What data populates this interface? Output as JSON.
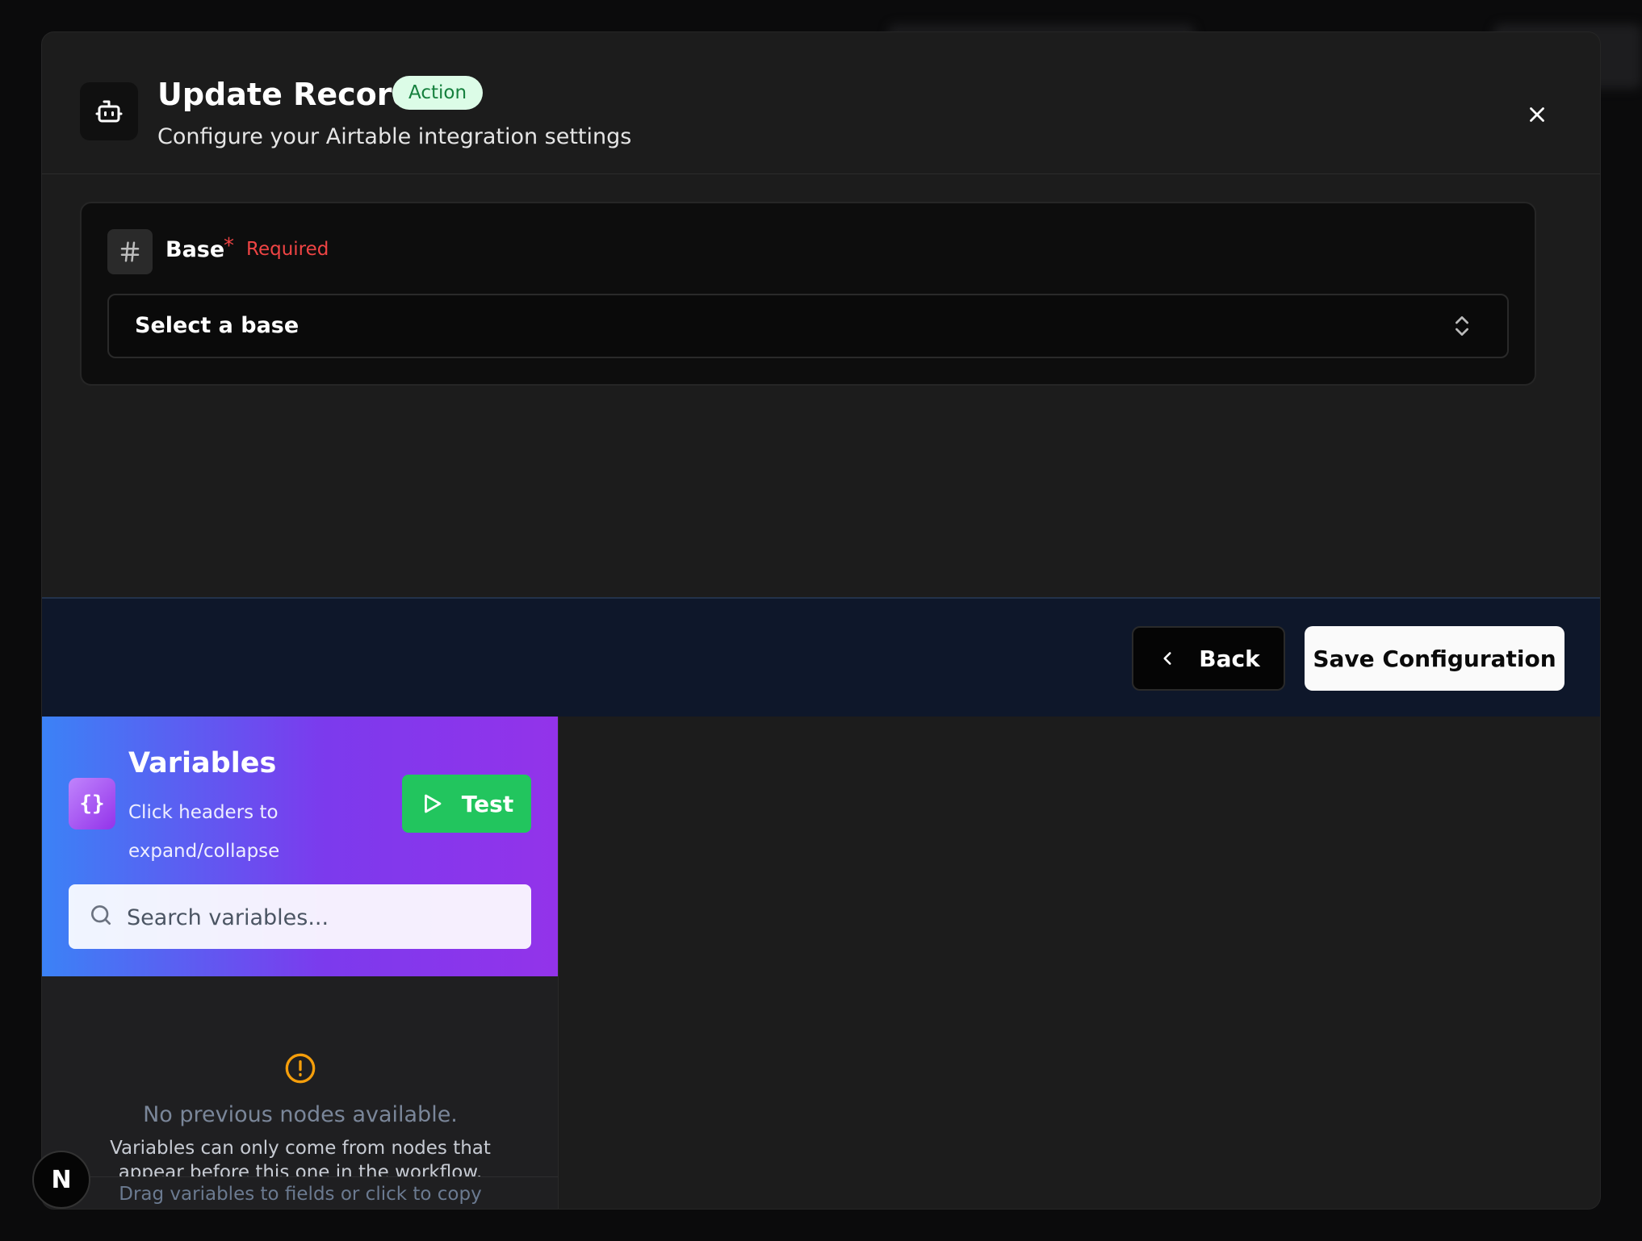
{
  "header": {
    "title": "Update Record",
    "badge": "Action",
    "subtitle": "Configure your Airtable integration settings",
    "icon": "bot-icon",
    "close_icon": "close-icon"
  },
  "base_field": {
    "label": "Base",
    "required_marker": "*",
    "required_text": "Required",
    "select_value": "Select a base"
  },
  "footer": {
    "back_label": "Back",
    "save_label": "Save Configuration"
  },
  "variables_panel": {
    "title": "Variables",
    "subtitle": "Click headers to expand/collapse",
    "test_label": "Test",
    "search_placeholder": "Search variables...",
    "empty_title": "No previous nodes available.",
    "empty_desc": "Variables can only come from nodes that appear before this one in the workflow.",
    "footer_hint": "Drag variables to fields or click to copy"
  },
  "floating_badge": "N",
  "colors": {
    "accent_green": "#22c55e",
    "badge_bg": "#dcfce7",
    "badge_text": "#15803d",
    "required_red": "#ef4444",
    "gradient_start": "#3b82f6",
    "gradient_end": "#9333ea"
  }
}
